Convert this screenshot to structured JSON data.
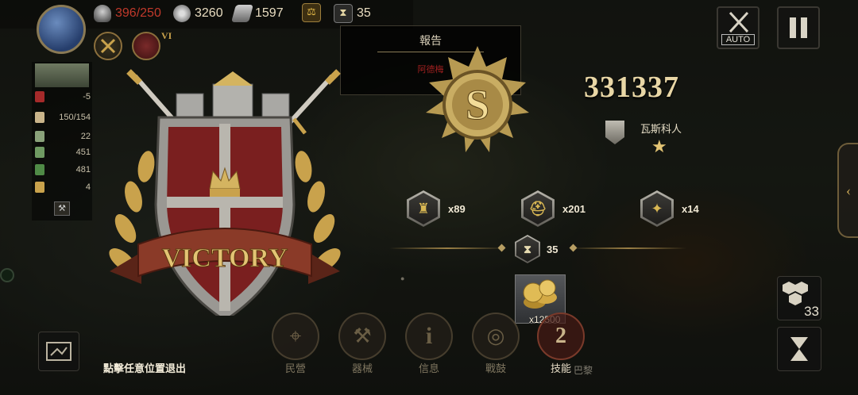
{
  "resources": {
    "troops": "396/250",
    "troops_color": "#c0392b",
    "silver": "3260",
    "iron": "1597",
    "hourglass": "35"
  },
  "general": {
    "rank": "VI"
  },
  "left_stats": [
    {
      "icon": "boot-icon",
      "value": "-5"
    },
    {
      "icon": "eagle-icon",
      "value": "150/154"
    },
    {
      "icon": "shield-icon",
      "value": "22"
    },
    {
      "icon": "defense-icon",
      "value": "451"
    },
    {
      "icon": "swords-icon",
      "value": "481"
    },
    {
      "icon": "boot-speed-icon",
      "value": "4"
    }
  ],
  "report": {
    "title": "報告",
    "subtitle": "阿德梅"
  },
  "controls": {
    "auto_label": "AUTO"
  },
  "result": {
    "banner": "VICTORY",
    "score": "331337",
    "defeated_name": "瓦斯科人",
    "star": "★"
  },
  "rewards": [
    {
      "icon": "city-icon",
      "amount": "x89"
    },
    {
      "icon": "helmet-icon",
      "amount": "x201"
    },
    {
      "icon": "rank-icon",
      "amount": "x14"
    }
  ],
  "hourglass_reward": "35",
  "coin_reward": "x12500",
  "bottom_menu": [
    {
      "icon": "map-pin-icon",
      "label": "民營"
    },
    {
      "icon": "catapult-icon",
      "label": "器械"
    },
    {
      "icon": "info-icon",
      "label": "信息"
    },
    {
      "icon": "drum-icon",
      "label": "戰鼓"
    },
    {
      "icon": "skill-icon",
      "label": "技能",
      "badge": "2"
    }
  ],
  "exit_hint": "點擊任意位置退出",
  "map_labels": {
    "town_bottom": "巴黎"
  },
  "right_panel": {
    "units_count": "33"
  },
  "colors": {
    "gold": "#d4b460",
    "shield_red": "#7a1f1f",
    "ribbon": "#8a3a28"
  }
}
